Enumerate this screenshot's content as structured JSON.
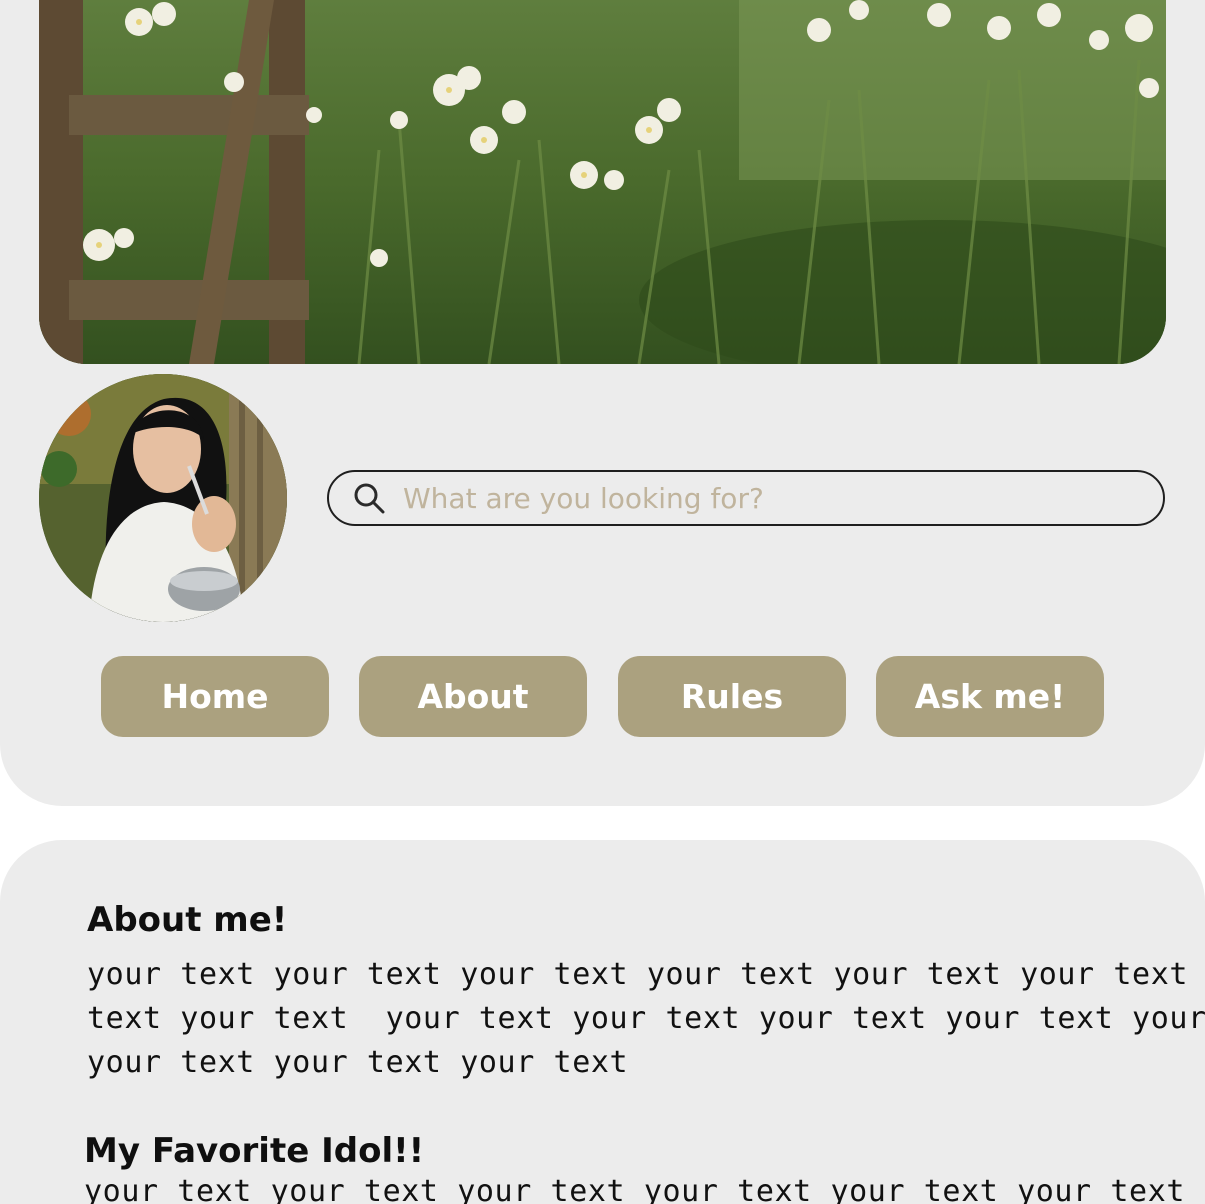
{
  "header": {
    "banner_alt": "garden banner",
    "avatar_alt": "profile photo"
  },
  "search": {
    "placeholder": "What are you looking for?",
    "value": ""
  },
  "nav": {
    "items": [
      {
        "label": "Home"
      },
      {
        "label": "About"
      },
      {
        "label": "Rules"
      },
      {
        "label": "Ask me!"
      }
    ]
  },
  "about": {
    "heading": "About me!",
    "lines": [
      "your text your text your text your text your text your text your",
      "text your text  your text your text your text your text your text",
      "your text your text your text"
    ]
  },
  "idol": {
    "heading": "My Favorite Idol!!",
    "lines": [
      "your text your text your text your text your text your text your"
    ]
  },
  "colors": {
    "card_bg": "#ececec",
    "nav_button": "#aba17f",
    "placeholder": "#c0b49d"
  },
  "icons": {
    "search": "search-icon"
  }
}
